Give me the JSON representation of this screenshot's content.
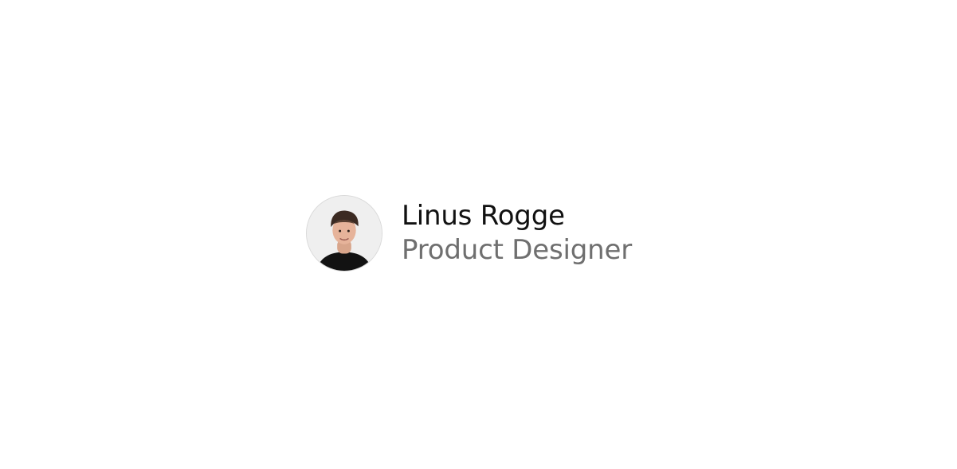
{
  "profile": {
    "name": "Linus Rogge",
    "role": "Product Designer"
  },
  "colors": {
    "background": "#ffffff",
    "name_text": "#111111",
    "role_text": "#6f6f6f",
    "avatar_bg": "#efefef"
  },
  "icons": {
    "avatar": "person-photo"
  }
}
